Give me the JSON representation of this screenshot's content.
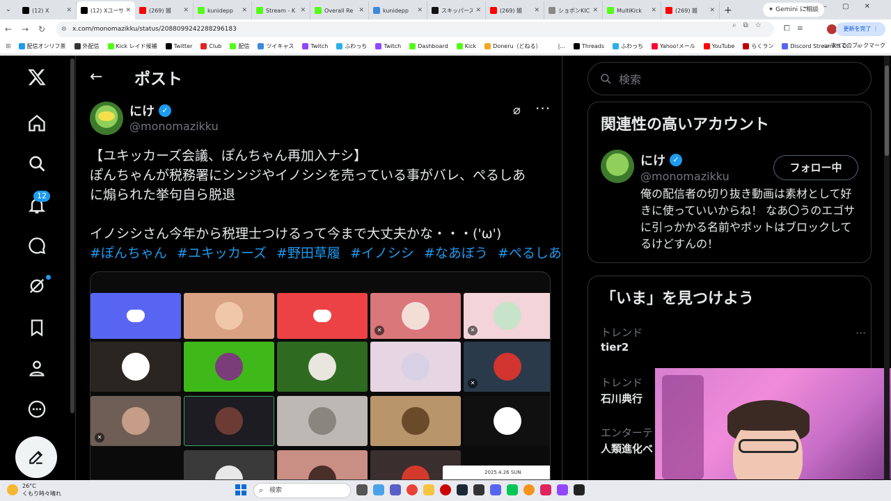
{
  "browser": {
    "tabs": [
      {
        "title": "(12) X",
        "color": "#000000",
        "active": false
      },
      {
        "title": "(12) Xユーザー",
        "color": "#000000",
        "active": true
      },
      {
        "title": "(269) 雑",
        "color": "#ff0000",
        "active": false
      },
      {
        "title": "kunidepp",
        "color": "#53fc18",
        "active": false
      },
      {
        "title": "Stream - K",
        "color": "#53fc18",
        "active": false
      },
      {
        "title": "Overall Re",
        "color": "#53fc18",
        "active": false
      },
      {
        "title": "kunidepp",
        "color": "#3c8bd9",
        "active": false
      },
      {
        "title": "スキッパーズ",
        "color": "#111111",
        "active": false
      },
      {
        "title": "(269) 雑",
        "color": "#ff0000",
        "active": false
      },
      {
        "title": "ショボンKIC",
        "color": "#888888",
        "active": false
      },
      {
        "title": "MultiKick",
        "color": "#53fc18",
        "active": false
      },
      {
        "title": "(269) 雑",
        "color": "#ff0000",
        "active": false
      }
    ],
    "new_tab": "+",
    "gemini_label": "✦ Gemini に相談",
    "url": "x.com/monomazikku/status/2088099242288296183",
    "update_label": "更新を完了 ⋮",
    "bookmarks": [
      {
        "label": "配信オンリフ茶",
        "color": "#1d9bf0"
      },
      {
        "label": "外配信",
        "color": "#333333"
      },
      {
        "label": "Kick レイド候補",
        "color": "#53fc18"
      },
      {
        "label": "Twitter",
        "color": "#000000"
      },
      {
        "label": "Club",
        "color": "#e02424"
      },
      {
        "label": "配信",
        "color": "#53fc18"
      },
      {
        "label": "ツイキャス",
        "color": "#3c8bd9"
      },
      {
        "label": "Twitch",
        "color": "#9146ff"
      },
      {
        "label": "ふわっち",
        "color": "#2bb0e6"
      },
      {
        "label": "Twitch",
        "color": "#9146ff"
      },
      {
        "label": "Dashboard",
        "color": "#53fc18"
      },
      {
        "label": "Kick",
        "color": "#53fc18"
      },
      {
        "label": "Doneru（どねる）",
        "color": "#f5a623"
      },
      {
        "label": "|...",
        "color": "#ffffff"
      },
      {
        "label": "Threads",
        "color": "#000000"
      },
      {
        "label": "ふわっち",
        "color": "#2bb0e6"
      },
      {
        "label": "Yahoo!メール",
        "color": "#ff0033"
      },
      {
        "label": "YouTube",
        "color": "#ff0000"
      },
      {
        "label": "らくラン",
        "color": "#bf0000"
      },
      {
        "label": "Discord StreamKit O...",
        "color": "#5865f2"
      }
    ],
    "bookmarks_more": "»",
    "all_bookmarks": "すべてのブックマーク"
  },
  "nav": {
    "notifications_badge": "12",
    "icons": [
      "x-logo-icon",
      "home-icon",
      "search-icon",
      "notifications-icon",
      "messages-icon",
      "grok-icon",
      "bookmarks-icon",
      "profile-icon",
      "more-icon"
    ]
  },
  "post": {
    "header_title": "ポスト",
    "author_name": "にけ",
    "author_handle": "@monomazikku",
    "lines": [
      "【ユキッカーズ会議、ぽんちゃん再加入ナシ】",
      "ぽんちゃんが税務署にシンジやイノシシを売っている事がバレ、ぺるしあ",
      "に煽られた挙句自ら脱退",
      "",
      "イノシシさん今年から税理士つけるって今まで大丈夫かな・・・('ω')"
    ],
    "hashtags": [
      "#ぽんちゃん",
      "#ユキッカーズ",
      "#野田草履",
      "#イノシシ",
      "#なあぼう",
      "#ぺるしあ"
    ],
    "media_stamp": "2025.4.26 SUN"
  },
  "sidebar": {
    "search_placeholder": "検索",
    "related_title": "関連性の高いアカウント",
    "related_name": "にけ",
    "related_handle": "@monomazikku",
    "follow_label": "フォロー中",
    "related_bio": "俺の配信者の切り抜き動画は素材として好きに使っていいからね！ なあ〇うのエゴサに引っかかる名前やボットはブロックしてるけどすんの！",
    "explore_title": "「いま」を見つけよう",
    "trends": [
      {
        "label": "トレンド",
        "name": "tier2"
      },
      {
        "label": "トレンド",
        "name": "石川典行"
      },
      {
        "label": "エンターテ",
        "name": "人類進化ベ"
      }
    ]
  },
  "taskbar": {
    "temp": "26°C",
    "weather": "くもり時々晴れ",
    "search_label": "検索"
  }
}
